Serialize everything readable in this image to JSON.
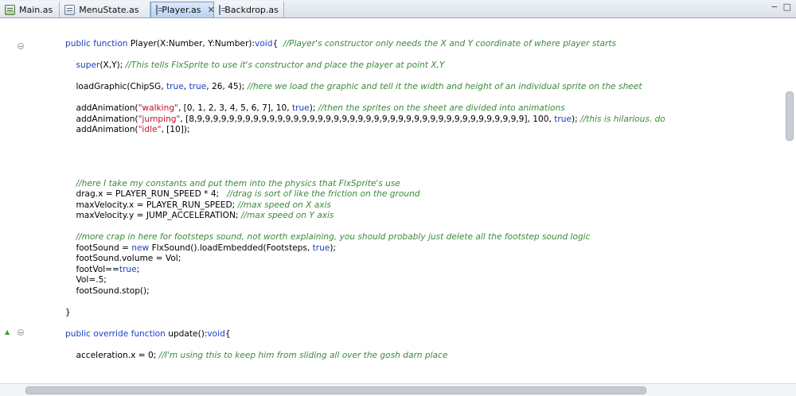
{
  "tabs": [
    {
      "label": "Main.as",
      "icon": "as-main-file-icon",
      "active": false
    },
    {
      "label": "MenuState.as",
      "icon": "as-file-icon",
      "active": false
    },
    {
      "label": "Player.as",
      "icon": "as-file-icon",
      "active": true,
      "close": "✕"
    },
    {
      "label": "Backdrop.as",
      "icon": "as-file-icon",
      "active": false
    }
  ],
  "window_controls": {
    "minimize": "−",
    "maximize": "□"
  },
  "colors": {
    "keyword": "#1c3fbf",
    "comment": "#3a8a3a",
    "string": "#b8122f"
  },
  "code_lines": [
    [
      [
        "kw",
        "public function"
      ],
      [
        "t",
        " Player(X:Number, Y:Number):"
      ],
      [
        "kw",
        "void"
      ],
      [
        "t",
        "{  "
      ],
      [
        "com",
        "//Player's constructor only needs the X and Y coordinate of where player starts"
      ]
    ],
    [],
    [
      [
        "t",
        "    "
      ],
      [
        "kw",
        "super"
      ],
      [
        "t",
        "(X,Y); "
      ],
      [
        "com",
        "//This tells FlxSprite to use it's constructor and place the player at point X,Y"
      ]
    ],
    [],
    [
      [
        "t",
        "    loadGraphic(ChipSG, "
      ],
      [
        "kw",
        "true"
      ],
      [
        "t",
        ", "
      ],
      [
        "kw",
        "true"
      ],
      [
        "t",
        ", 26, 45); "
      ],
      [
        "com",
        "//here we load the graphic and tell it the width and height of an individual sprite on the sheet"
      ]
    ],
    [],
    [
      [
        "t",
        "    addAnimation("
      ],
      [
        "str",
        "\"walking\""
      ],
      [
        "t",
        ", [0, 1, 2, 3, 4, 5, 6, 7], 10, "
      ],
      [
        "kw",
        "true"
      ],
      [
        "t",
        "); "
      ],
      [
        "com",
        "//then the sprites on the sheet are divided into animations"
      ]
    ],
    [
      [
        "t",
        "    addAnimation("
      ],
      [
        "str",
        "\"jumping\""
      ],
      [
        "t",
        ", [8,9,9,9,9,9,9,9,9,9,9,9,9,9,9,9,9,9,9,9,9,9,9,9,9,9,9,9,9,9,9,9,9,9,9,9,9,9,9,9,9,9], 100, "
      ],
      [
        "kw",
        "true"
      ],
      [
        "t",
        "); "
      ],
      [
        "com",
        "//this is hilarious. do"
      ]
    ],
    [
      [
        "t",
        "    addAnimation("
      ],
      [
        "str",
        "\"idle\""
      ],
      [
        "t",
        ", [10]);"
      ]
    ],
    [],
    [],
    [],
    [],
    [
      [
        "t",
        "    "
      ],
      [
        "com",
        "//here I take my constants and put them into the physics that FlxSprite's use"
      ]
    ],
    [
      [
        "t",
        "    drag.x = PLAYER_RUN_SPEED * 4;   "
      ],
      [
        "com",
        "//drag is sort of like the friction on the ground"
      ]
    ],
    [
      [
        "t",
        "    maxVelocity.x = PLAYER_RUN_SPEED; "
      ],
      [
        "com",
        "//max speed on X axis"
      ]
    ],
    [
      [
        "t",
        "    maxVelocity.y = JUMP_ACCELERATION; "
      ],
      [
        "com",
        "//max speed on Y axis"
      ]
    ],
    [],
    [
      [
        "t",
        "    "
      ],
      [
        "com",
        "//more crap in here for footsteps sound, not worth explaining, you should probably just delete all the footstep sound logic"
      ]
    ],
    [
      [
        "t",
        "    footSound = "
      ],
      [
        "kw",
        "new"
      ],
      [
        "t",
        " FlxSound().loadEmbedded(Footsteps, "
      ],
      [
        "kw",
        "true"
      ],
      [
        "t",
        ");"
      ]
    ],
    [
      [
        "t",
        "    footSound.volume = Vol;"
      ]
    ],
    [
      [
        "t",
        "    footVol=="
      ],
      [
        "kw",
        "true"
      ],
      [
        "t",
        ";"
      ]
    ],
    [
      [
        "t",
        "    Vol=.5;"
      ]
    ],
    [
      [
        "t",
        "    footSound.stop();"
      ]
    ],
    [],
    [
      [
        "t",
        "}"
      ]
    ],
    [],
    [
      [
        "kw",
        "public override function"
      ],
      [
        "t",
        " update():"
      ],
      [
        "kw",
        "void"
      ],
      [
        "t",
        "{"
      ]
    ],
    [],
    [
      [
        "t",
        "    acceleration.x = 0; "
      ],
      [
        "com",
        "//I'm using this to keep him from sliding all over the gosh darn place"
      ]
    ]
  ]
}
